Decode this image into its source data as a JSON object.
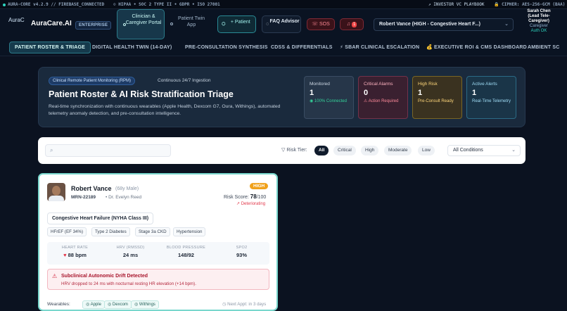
{
  "statusbar": {
    "core": "AURA-CORE v4.2.9 // FIREBASE_CONNECTED",
    "compliance": "HIPAA • SOC 2 TYPE II • GDPR • ISO 27001",
    "investor": "↗ INVESTOR VC PLAYBOOK",
    "cipher": "CIPHER: AES-256-GCM (BAA)"
  },
  "header": {
    "logo_alt": "AuraC",
    "brand": "AuraCare.AI",
    "edition": "ENTERPRISE",
    "portal_active": "Clinician & Caregiver Portal",
    "portal_other": "Patient Twin App",
    "add_patient": "+ Patient",
    "faq": "FAQ Advisor",
    "sos": "SOS",
    "alert_count": "1",
    "patient_select": "Robert Vance (HIGH - Congestive Heart F...)",
    "user_name": "Sarah Chen",
    "user_role": "(Lead Tele-Caregiver)",
    "user_type": "Caregiver",
    "auth": "Auth OK"
  },
  "tabs": [
    "PATIENT ROSTER & TRIAGE",
    "DIGITAL HEALTH TWIN (14-DAY)",
    "PRE-CONSULTATION SYNTHESIS",
    "CDSS & DIFFERENTIALS",
    "⚡ SBAR CLINICAL ESCALATION",
    "💰 EXECUTIVE ROI & CMS DASHBOARD",
    "AMBIENT SC"
  ],
  "hero": {
    "badge": "Clinical Remote Patient Monitoring (RPM)",
    "ingest": "Continuous 24/7 Ingestion",
    "title": "Patient Roster & AI Risk Stratification Triage",
    "desc": "Real-time synchronization with continuous wearables (Apple Health, Dexcom G7, Oura, Withings), automated telemetry anomaly detection, and pre-consultation intelligence.",
    "stats": [
      {
        "label": "Monitored",
        "value": "1",
        "sub": "100% Connected"
      },
      {
        "label": "Critical Alarms",
        "value": "0",
        "sub": "Action Required"
      },
      {
        "label": "High Risk",
        "value": "1",
        "sub": "Pre-Consult Ready"
      },
      {
        "label": "Active Alerts",
        "value": "1",
        "sub": "Real-Time Telemetry"
      }
    ]
  },
  "filters": {
    "search_placeholder": "",
    "risk_label": "Risk Tier:",
    "chips": [
      "All",
      "Critical",
      "High",
      "Moderate",
      "Low"
    ],
    "condition_select": "All Conditions"
  },
  "patient": {
    "name": "Robert Vance",
    "age": "(68y Male)",
    "mrn": "MRN-22189",
    "doctor": "Dr. Evelyn Reed",
    "risk_tier": "HIGH",
    "risk_score_label": "Risk Score:",
    "risk_score": "78",
    "risk_max": "/100",
    "trend": "Deteriorating",
    "condition": "Congestive Heart Failure (NYHA Class III)",
    "tags": [
      "HFrEF (EF 34%)",
      "Type 2 Diabetes",
      "Stage 3a CKD",
      "Hypertension"
    ],
    "vitals": [
      {
        "label": "HEART RATE",
        "value": "88 bpm"
      },
      {
        "label": "HRV (RMSSD)",
        "value": "24 ms"
      },
      {
        "label": "BLOOD PRESSURE",
        "value": "148/92"
      },
      {
        "label": "SPO2",
        "value": "93%"
      }
    ],
    "alert_title": "Subclinical Autonomic Drift Detected",
    "alert_desc": "HRV dropped to 24 ms with nocturnal resting HR elevation (+14 bpm).",
    "wearables_label": "Wearables:",
    "wearables": [
      "Apple",
      "Dexcom",
      "Withings"
    ],
    "next_appt": "Next Appt: in 3 days"
  }
}
